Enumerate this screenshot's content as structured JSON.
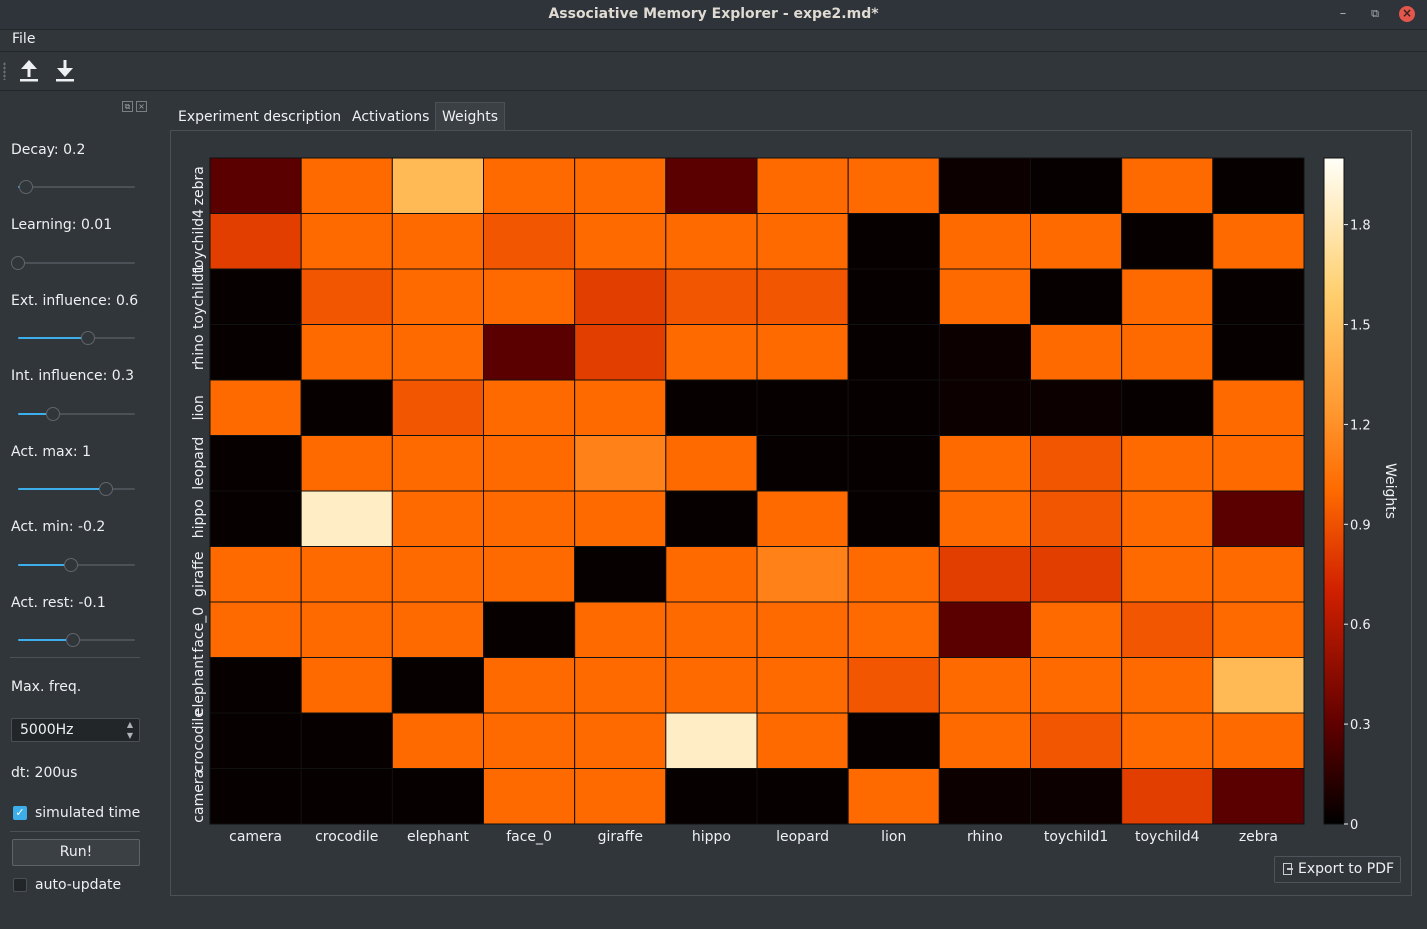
{
  "window": {
    "title": "Associative Memory Explorer - expe2.md*"
  },
  "menu": {
    "items": [
      "File"
    ]
  },
  "toolbar": {
    "buttons": [
      "upload-icon",
      "download-icon"
    ]
  },
  "sidebar": {
    "params": [
      {
        "label": "Decay: 0.2",
        "fraction": 0.07
      },
      {
        "label": "Learning: 0.01",
        "fraction": 0.0
      },
      {
        "label": "Ext. influence: 0.6",
        "fraction": 0.6
      },
      {
        "label": "Int. influence: 0.3",
        "fraction": 0.3
      },
      {
        "label": "Act. max: 1",
        "fraction": 0.75
      },
      {
        "label": "Act. min: -0.2",
        "fraction": 0.45
      },
      {
        "label": "Act. rest: -0.1",
        "fraction": 0.47
      }
    ],
    "max_freq_label": "Max. freq.",
    "max_freq_value": "5000Hz",
    "dt_label": "dt: 200us",
    "simulated_time_label": "simulated time",
    "simulated_time_checked": true,
    "run_label": "Run!",
    "auto_update_label": "auto-update",
    "auto_update_checked": false
  },
  "tabs": [
    {
      "label": "Experiment description",
      "active": false
    },
    {
      "label": "Activations",
      "active": false
    },
    {
      "label": "Weights",
      "active": true
    }
  ],
  "export_label": "Export to PDF",
  "chart_data": {
    "type": "heatmap",
    "title": "",
    "colormap": "gist_heat",
    "x_categories": [
      "camera",
      "crocodile",
      "elephant",
      "face_0",
      "giraffe",
      "hippo",
      "leopard",
      "lion",
      "rhino",
      "toychild1",
      "toychild4",
      "zebra"
    ],
    "y_categories": [
      "camera",
      "crocodile",
      "elephant",
      "face_0",
      "giraffe",
      "hippo",
      "leopard",
      "lion",
      "rhino",
      "toychild1",
      "toychild4",
      "zebra"
    ],
    "values": [
      [
        0.02,
        0.02,
        0.02,
        1.0,
        1.0,
        0.02,
        0.02,
        1.0,
        0.04,
        0.04,
        0.82,
        0.28
      ],
      [
        0.02,
        0.02,
        1.0,
        1.0,
        1.0,
        1.85,
        1.0,
        0.02,
        1.0,
        0.92,
        1.0,
        1.0
      ],
      [
        0.02,
        1.0,
        0.02,
        1.0,
        1.0,
        1.0,
        1.0,
        0.92,
        1.0,
        1.0,
        1.0,
        1.45
      ],
      [
        1.0,
        1.0,
        1.0,
        0.02,
        1.0,
        1.0,
        1.0,
        1.0,
        0.28,
        1.0,
        0.92,
        1.0
      ],
      [
        1.0,
        1.0,
        1.0,
        1.0,
        0.02,
        1.0,
        1.12,
        1.0,
        0.82,
        0.82,
        1.0,
        1.0
      ],
      [
        0.02,
        1.85,
        1.0,
        1.0,
        1.0,
        0.02,
        1.0,
        0.02,
        1.0,
        0.92,
        1.0,
        0.28
      ],
      [
        0.02,
        1.0,
        1.0,
        1.0,
        1.12,
        1.0,
        0.02,
        0.02,
        1.0,
        0.92,
        1.0,
        1.0
      ],
      [
        1.0,
        0.02,
        0.92,
        1.0,
        1.0,
        0.02,
        0.02,
        0.02,
        0.04,
        0.04,
        0.02,
        1.0
      ],
      [
        0.02,
        1.0,
        1.0,
        0.28,
        0.82,
        1.0,
        1.0,
        0.02,
        0.04,
        1.0,
        1.0,
        0.02
      ],
      [
        0.02,
        0.92,
        1.0,
        1.0,
        0.82,
        0.92,
        0.92,
        0.02,
        1.0,
        0.02,
        1.0,
        0.02
      ],
      [
        0.82,
        1.0,
        1.0,
        0.92,
        1.0,
        1.0,
        1.0,
        0.02,
        1.0,
        1.0,
        0.02,
        1.0
      ],
      [
        0.28,
        1.0,
        1.45,
        1.0,
        1.0,
        0.28,
        1.0,
        1.0,
        0.04,
        0.02,
        1.0,
        0.02
      ]
    ],
    "colorbar": {
      "label": "Weights",
      "min": 0,
      "max": 2.0,
      "ticks": [
        0,
        0.3,
        0.6,
        0.9,
        1.2,
        1.5,
        1.8
      ]
    }
  }
}
